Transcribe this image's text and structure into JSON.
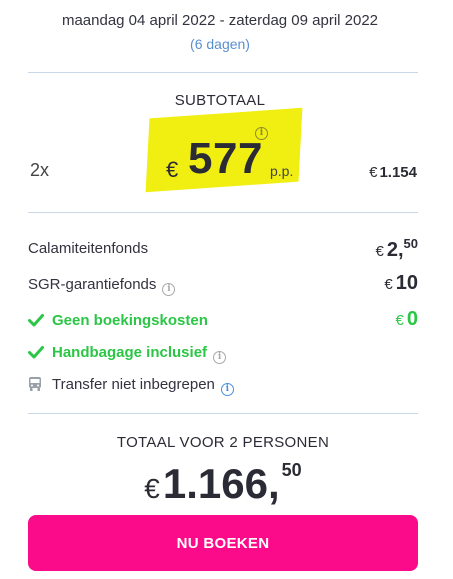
{
  "trip": {
    "dates": "maandag 04 april 2022  -  zaterdag 09 april 2022",
    "duration": "(6 dagen)"
  },
  "subtotal": {
    "label": "SUBTOTAAL",
    "quantity": "2x",
    "currency": "€",
    "price_per_person": "577",
    "per_person_suffix": "p.p.",
    "total_currency": "€",
    "total": "1.154"
  },
  "costs": [
    {
      "label": "Calamiteitenfonds",
      "currency": "€",
      "amount": "2,",
      "cents": "50",
      "info": false
    },
    {
      "label": "SGR-garantiefonds",
      "currency": "€",
      "amount": "10",
      "cents": "",
      "info": true
    },
    {
      "label": "Geen boekingskosten",
      "currency": "€",
      "amount": "0",
      "cents": "",
      "info": false
    }
  ],
  "features": {
    "hand_luggage": "Handbagage inclusief",
    "transfer": "Transfer niet inbegrepen"
  },
  "total": {
    "label": "TOTAAL VOOR 2 PERSONEN",
    "currency": "€",
    "amount": "1.166,",
    "cents": "50"
  },
  "cta": {
    "label": "NU BOEKEN"
  },
  "colors": {
    "accent": "#fb0b89",
    "positive": "#2bc646",
    "highlight": "#f1ee12",
    "info": "#4a90d9"
  }
}
